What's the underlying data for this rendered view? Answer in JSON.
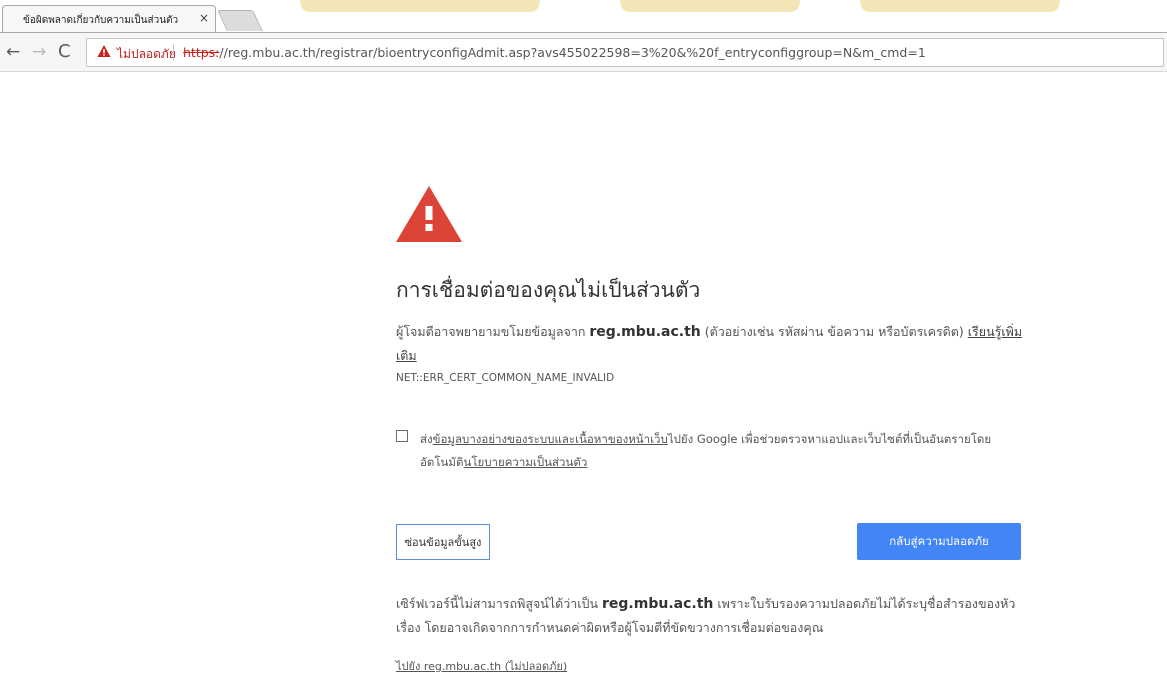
{
  "browser": {
    "tab": {
      "title": "ข้อผิดพลาดเกี่ยวกับความเป็นส่วนตัว",
      "close_glyph": "×"
    },
    "toolbar": {
      "back_glyph": "←",
      "forward_glyph": "→",
      "reload_glyph": "C",
      "security_label": "ไม่ปลอดภัย",
      "url_scheme": "https:",
      "url_rest": "//reg.mbu.ac.th/registrar/bioentryconfigAdmit.asp?avs455022598=3%20&%20f_entryconfiggroup=N&m_cmd=1"
    },
    "icons": [
      "back-arrow-icon",
      "forward-arrow-icon",
      "reload-icon",
      "warning-triangle-icon"
    ]
  },
  "interstitial": {
    "heading": "การเชื่อมต่อของคุณไม่เป็นส่วนตัว",
    "para_prefix": "ผู้โจมตีอาจพยายามขโมยข้อมูลจาก ",
    "domain": "reg.mbu.ac.th",
    "para_suffix": " (ตัวอย่างเช่น รหัสผ่าน ข้อความ หรือบัตรเครดิต) ",
    "learn_more": "เรียนรู้เพิ่มเติม",
    "error_code": "NET::ERR_CERT_COMMON_NAME_INVALID",
    "checkbox": {
      "checked": false,
      "text_prefix": "ส่ง",
      "link1": "ข้อมูลบางอย่างของระบบและเนื้อหาของหน้าเว็บ",
      "text_middle": "ไปยัง Google เพื่อช่วยตรวจหาแอปและเว็บไซต์ที่เป็นอันตรายโดยอัตโนมัติ",
      "link2": "นโยบายความเป็นส่วนตัว"
    },
    "advanced_button": "ซ่อนข้อมูลขั้นสูง",
    "back_button": "กลับสู่ความปลอดภัย",
    "detail_prefix": "เซิร์ฟเวอร์นี้ไม่สามารถพิสูจน์ได้ว่าเป็น ",
    "detail_domain": "reg.mbu.ac.th",
    "detail_suffix": " เพราะใบรับรองความปลอดภัยไม่ได้ระบุชื่อสำรองของหัวเรื่อง โดยอาจเกิดจากการกำหนดค่าผิดหรือผู้โจมตีที่ขัดขวางการเชื่อมต่อของคุณ",
    "proceed_link": "ไปยัง reg.mbu.ac.th (ไม่ปลอดภัย)"
  },
  "colors": {
    "accent_blue": "#4285f4",
    "warning_red": "#db4437",
    "insecure_red": "#c5221f"
  }
}
